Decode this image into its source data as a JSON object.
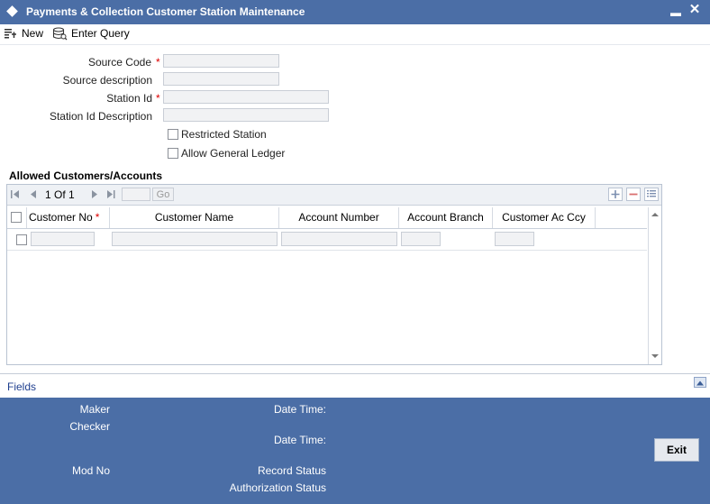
{
  "window": {
    "title": "Payments & Collection Customer Station Maintenance",
    "minimize_glyph": "▬",
    "close_glyph": "✕"
  },
  "toolbar": {
    "new_label": "New",
    "enter_query_label": "Enter Query"
  },
  "form": {
    "source_code_label": "Source Code",
    "source_description_label": "Source description",
    "station_id_label": "Station Id",
    "station_id_description_label": "Station Id Description",
    "required_marker": "*",
    "restricted_station_label": "Restricted Station",
    "allow_general_ledger_label": "Allow General Ledger",
    "source_code_value": "",
    "source_description_value": "",
    "station_id_value": "",
    "station_id_description_value": ""
  },
  "grid": {
    "section_title": "Allowed Customers/Accounts",
    "page_current": "1",
    "page_of": "Of",
    "page_total": "1",
    "go_label": "Go",
    "columns": [
      "Customer No",
      "Customer Name",
      "Account Number",
      "Account Branch",
      "Customer Ac Ccy"
    ],
    "rows": [
      {
        "customer_no": "",
        "customer_name": "",
        "account_number": "",
        "account_branch": "",
        "customer_ac_ccy": ""
      }
    ]
  },
  "fields_link": "Fields",
  "footer": {
    "maker_label": "Maker",
    "checker_label": "Checker",
    "date_time_label": "Date Time:",
    "mod_no_label": "Mod No",
    "record_status_label": "Record Status",
    "authorization_status_label": "Authorization Status",
    "exit_label": "Exit"
  },
  "colors": {
    "titlebar": "#4b6ea6",
    "footer": "#4b6ea6",
    "required": "#dd0000"
  },
  "icons": {
    "window": "diamond-icon",
    "new": "new-document-icon",
    "enter_query": "query-database-icon",
    "first_page": "first-page-icon",
    "prev_page": "previous-page-icon",
    "next_page": "next-page-icon",
    "last_page": "last-page-icon",
    "add_row": "plus-icon",
    "delete_row": "minus-icon",
    "single_view": "list-view-icon",
    "collapse_fields": "chevron-up-icon"
  }
}
